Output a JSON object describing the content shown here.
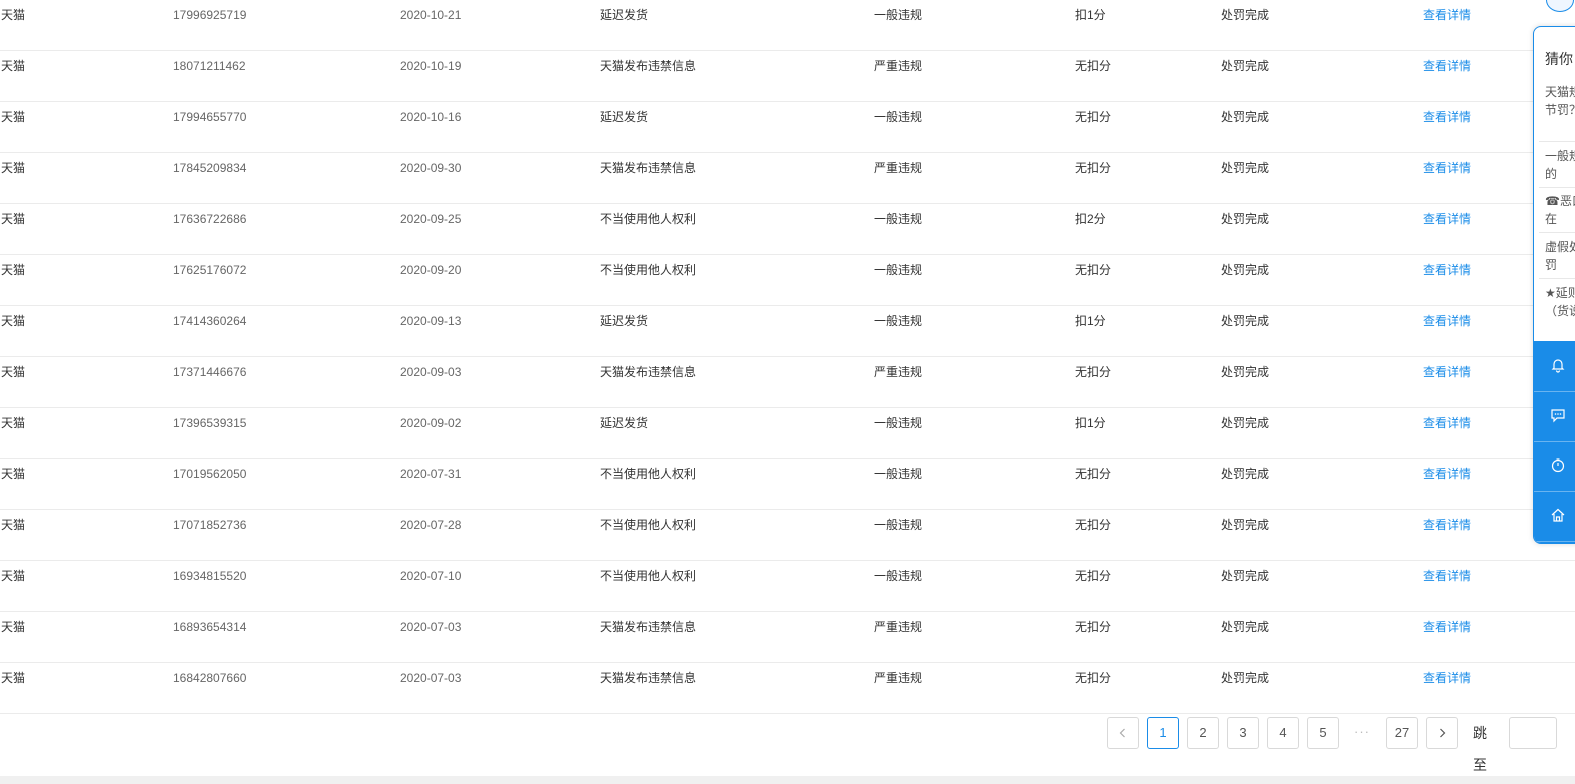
{
  "table": {
    "rows": [
      [
        "天猫",
        "17996925719",
        "2020-10-21",
        "延迟发货",
        "一般违规",
        "扣1分",
        "处罚完成",
        "查看详情"
      ],
      [
        "天猫",
        "18071211462",
        "2020-10-19",
        "天猫发布违禁信息",
        "严重违规",
        "无扣分",
        "处罚完成",
        "查看详情"
      ],
      [
        "天猫",
        "17994655770",
        "2020-10-16",
        "延迟发货",
        "一般违规",
        "无扣分",
        "处罚完成",
        "查看详情"
      ],
      [
        "天猫",
        "17845209834",
        "2020-09-30",
        "天猫发布违禁信息",
        "严重违规",
        "无扣分",
        "处罚完成",
        "查看详情"
      ],
      [
        "天猫",
        "17636722686",
        "2020-09-25",
        "不当使用他人权利",
        "一般违规",
        "扣2分",
        "处罚完成",
        "查看详情"
      ],
      [
        "天猫",
        "17625176072",
        "2020-09-20",
        "不当使用他人权利",
        "一般违规",
        "无扣分",
        "处罚完成",
        "查看详情"
      ],
      [
        "天猫",
        "17414360264",
        "2020-09-13",
        "延迟发货",
        "一般违规",
        "扣1分",
        "处罚完成",
        "查看详情"
      ],
      [
        "天猫",
        "17371446676",
        "2020-09-03",
        "天猫发布违禁信息",
        "严重违规",
        "无扣分",
        "处罚完成",
        "查看详情"
      ],
      [
        "天猫",
        "17396539315",
        "2020-09-02",
        "延迟发货",
        "一般违规",
        "扣1分",
        "处罚完成",
        "查看详情"
      ],
      [
        "天猫",
        "17019562050",
        "2020-07-31",
        "不当使用他人权利",
        "一般违规",
        "无扣分",
        "处罚完成",
        "查看详情"
      ],
      [
        "天猫",
        "17071852736",
        "2020-07-28",
        "不当使用他人权利",
        "一般违规",
        "无扣分",
        "处罚完成",
        "查看详情"
      ],
      [
        "天猫",
        "16934815520",
        "2020-07-10",
        "不当使用他人权利",
        "一般违规",
        "无扣分",
        "处罚完成",
        "查看详情"
      ],
      [
        "天猫",
        "16893654314",
        "2020-07-03",
        "天猫发布违禁信息",
        "严重违规",
        "无扣分",
        "处罚完成",
        "查看详情"
      ],
      [
        "天猫",
        "16842807660",
        "2020-07-03",
        "天猫发布违禁信息",
        "严重违规",
        "无扣分",
        "处罚完成",
        "查看详情"
      ]
    ]
  },
  "pagination": {
    "prev_icon": "chevron-left-icon",
    "next_icon": "chevron-right-icon",
    "pages": [
      "1",
      "2",
      "3",
      "4",
      "5"
    ],
    "ellipsis": "···",
    "last_page": "27",
    "current_page": 1,
    "jump_label": "跳至",
    "jump_value": ""
  },
  "side_panel": {
    "title": "猜你",
    "questions": [
      "天猫规节罚？",
      "一般规的",
      "☎恶口在",
      "虚假处罚",
      "★延则（货说"
    ],
    "buttons": [
      "bell-icon",
      "chat-icon",
      "timer-icon",
      "home-icon"
    ]
  },
  "colors": {
    "accent": "#1a8ce8",
    "text": "#333333",
    "muted": "#666666",
    "border": "#ebebeb"
  }
}
